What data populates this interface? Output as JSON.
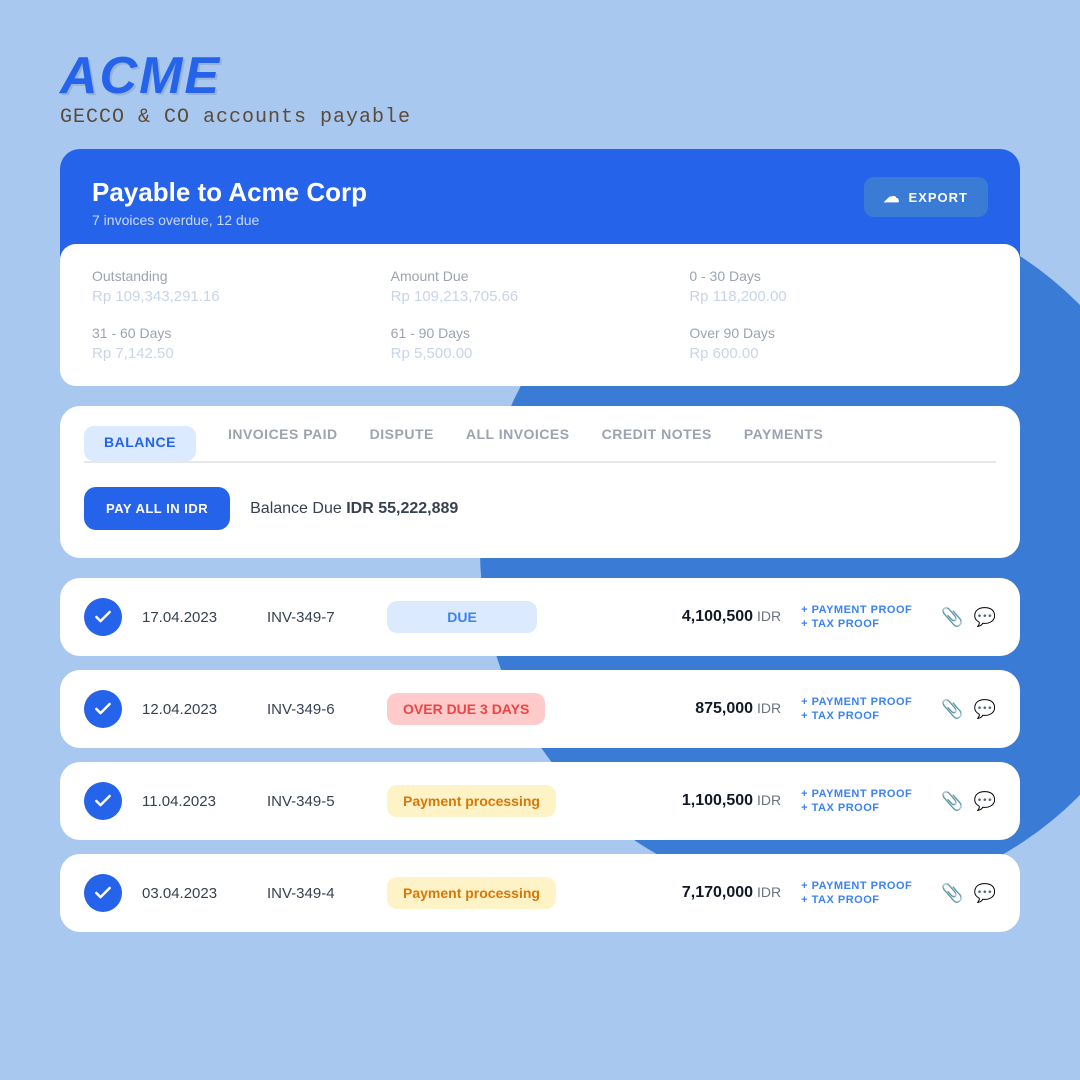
{
  "brand": {
    "logo": "ACME",
    "subtitle": "GECCO & CO accounts payable"
  },
  "summary_card": {
    "title": "Payable to Acme Corp",
    "subtitle": "7 invoices overdue, 12 due",
    "export_label": "EXPORT",
    "stats": [
      {
        "label": "Outstanding",
        "value": "Rp 109,343,291.16"
      },
      {
        "label": "Amount Due",
        "value": "Rp 109,213,705.66"
      },
      {
        "label": "0 - 30 Days",
        "value": "Rp 118,200.00"
      },
      {
        "label": "31 - 60 Days",
        "value": "Rp 7,142.50"
      },
      {
        "label": "61 - 90 Days",
        "value": "Rp 5,500.00"
      },
      {
        "label": "Over 90 Days",
        "value": "Rp 600.00"
      }
    ]
  },
  "tabs": {
    "items": [
      {
        "id": "balance",
        "label": "BALANCE",
        "active": true
      },
      {
        "id": "invoices-paid",
        "label": "INVOICES PAID",
        "active": false
      },
      {
        "id": "dispute",
        "label": "DISPUTE",
        "active": false
      },
      {
        "id": "all-invoices",
        "label": "ALL INVOICES",
        "active": false
      },
      {
        "id": "credit-notes",
        "label": "CREDIT NOTES",
        "active": false
      },
      {
        "id": "payments",
        "label": "PAYMENTS",
        "active": false
      }
    ],
    "pay_all_label": "PAY ALL IN IDR",
    "balance_due_text": "Balance Due",
    "balance_due_amount": "IDR 55,222,889"
  },
  "invoices": [
    {
      "date": "17.04.2023",
      "number": "INV-349-7",
      "status": "DUE",
      "status_type": "due",
      "amount": "4,100,500",
      "currency": "IDR",
      "payment_proof": "+ PAYMENT PROOF",
      "tax_proof": "+ TAX PROOF"
    },
    {
      "date": "12.04.2023",
      "number": "INV-349-6",
      "status": "OVER DUE 3 DAYS",
      "status_type": "overdue",
      "amount": "875,000",
      "currency": "IDR",
      "payment_proof": "+ PAYMENT PROOF",
      "tax_proof": "+ TAX PROOF"
    },
    {
      "date": "11.04.2023",
      "number": "INV-349-5",
      "status": "Payment processing",
      "status_type": "processing",
      "amount": "1,100,500",
      "currency": "IDR",
      "payment_proof": "+ PAYMENT PROOF",
      "tax_proof": "+ TAX PROOF"
    },
    {
      "date": "03.04.2023",
      "number": "INV-349-4",
      "status": "Payment processing",
      "status_type": "processing",
      "amount": "7,170,000",
      "currency": "IDR",
      "payment_proof": "+ PAYMENT PROOF",
      "tax_proof": "+ TAX PROOF"
    }
  ]
}
